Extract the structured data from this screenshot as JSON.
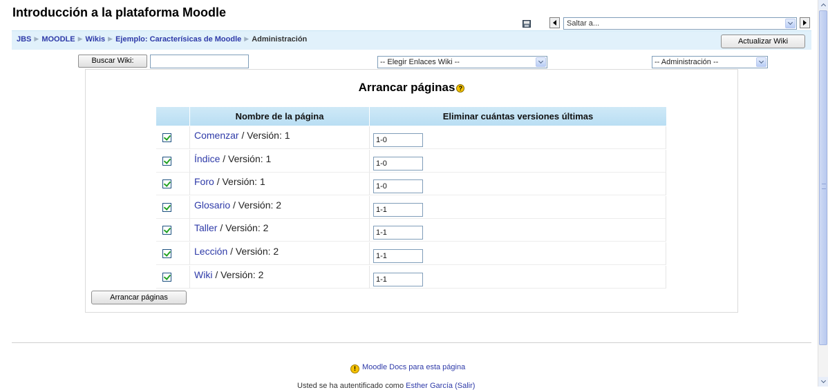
{
  "header": {
    "title": "Introducción a la plataforma Moodle",
    "jump_value": "Saltar a...",
    "save_icon": "save-icon",
    "prev_icon": "arrow-left-icon",
    "next_icon": "arrow-right-icon"
  },
  "breadcrumb": {
    "items": [
      "JBS",
      "MOODLE",
      "Wikis",
      "Ejemplo: Caracterísicas de Moodle"
    ],
    "current": "Administración"
  },
  "navbar": {
    "update_button": "Actualizar Wiki"
  },
  "toolbar": {
    "search_button": "Buscar Wiki:",
    "search_value": "",
    "links_select": "-- Elegir Enlaces Wiki --",
    "admin_select": "-- Administración --"
  },
  "main": {
    "heading": "Arrancar páginas",
    "help_icon": "help-icon",
    "columns": [
      "",
      "Nombre de la página",
      "Eliminar cuántas versiones últimas"
    ],
    "version_prefix": "/ Versión:",
    "rows": [
      {
        "page": "Comenzar",
        "version": "1",
        "remove": "1-0",
        "checked": true
      },
      {
        "page": "Índice",
        "version": "1",
        "remove": "1-0",
        "checked": true
      },
      {
        "page": "Foro",
        "version": "1",
        "remove": "1-0",
        "checked": true
      },
      {
        "page": "Glosario",
        "version": "2",
        "remove": "1-1",
        "checked": true
      },
      {
        "page": "Taller",
        "version": "2",
        "remove": "1-1",
        "checked": true
      },
      {
        "page": "Lección",
        "version": "2",
        "remove": "1-1",
        "checked": true
      },
      {
        "page": "Wiki",
        "version": "2",
        "remove": "1-1",
        "checked": true
      }
    ],
    "submit_button": "Arrancar páginas"
  },
  "footer": {
    "docs_link": "Moodle Docs para esta página",
    "login_text": "Usted se ha autentificado como",
    "login_user": "Esther García",
    "logout_link": "(Salir)"
  },
  "colors": {
    "navbar_bg": "#e1f1fb",
    "link": "#2e3aa8",
    "table_header": "#cfe9f7"
  }
}
